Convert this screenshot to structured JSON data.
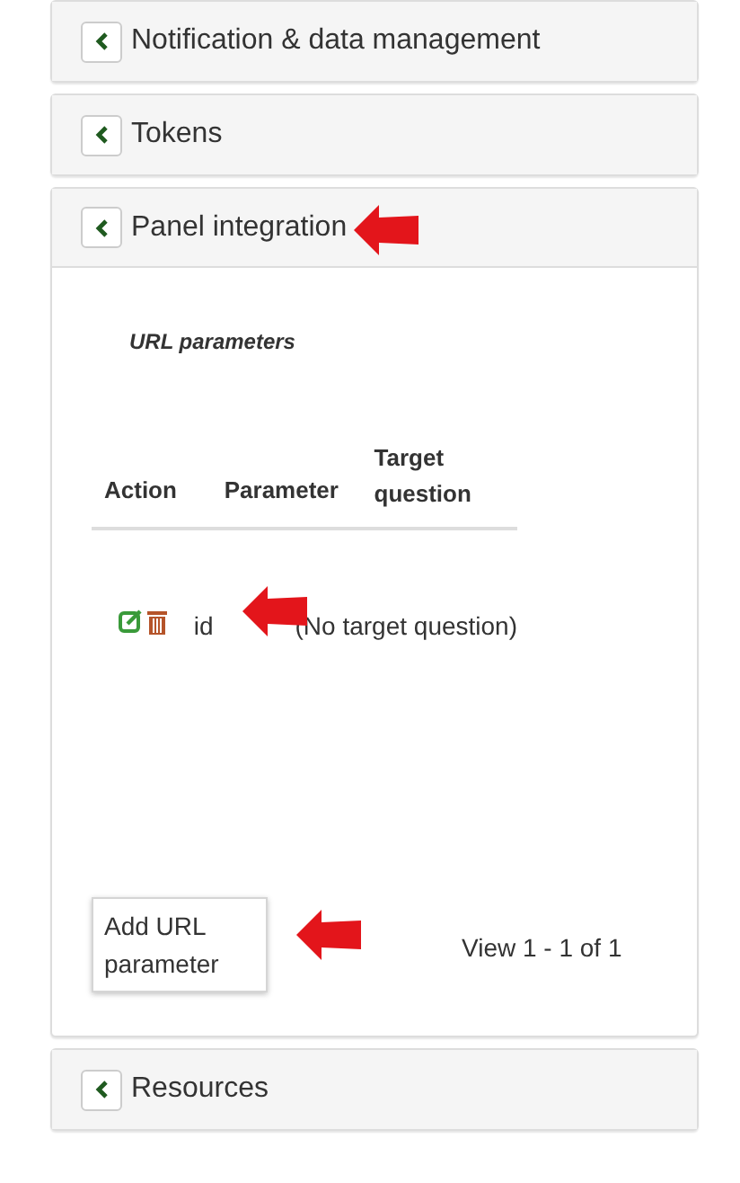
{
  "panels": [
    {
      "title": "Notification & data management",
      "expanded": false
    },
    {
      "title": "Tokens",
      "expanded": false
    },
    {
      "title": "Panel integration",
      "expanded": true,
      "content": {
        "section_title": "URL parameters",
        "table": {
          "columns": [
            "Action",
            "Parameter",
            "Target question"
          ],
          "rows": [
            {
              "parameter": "id",
              "target_question": "(No target question)"
            }
          ]
        },
        "add_button": "Add URL parameter",
        "pager": "View 1 - 1 of 1"
      }
    },
    {
      "title": "Resources",
      "expanded": false
    }
  ]
}
